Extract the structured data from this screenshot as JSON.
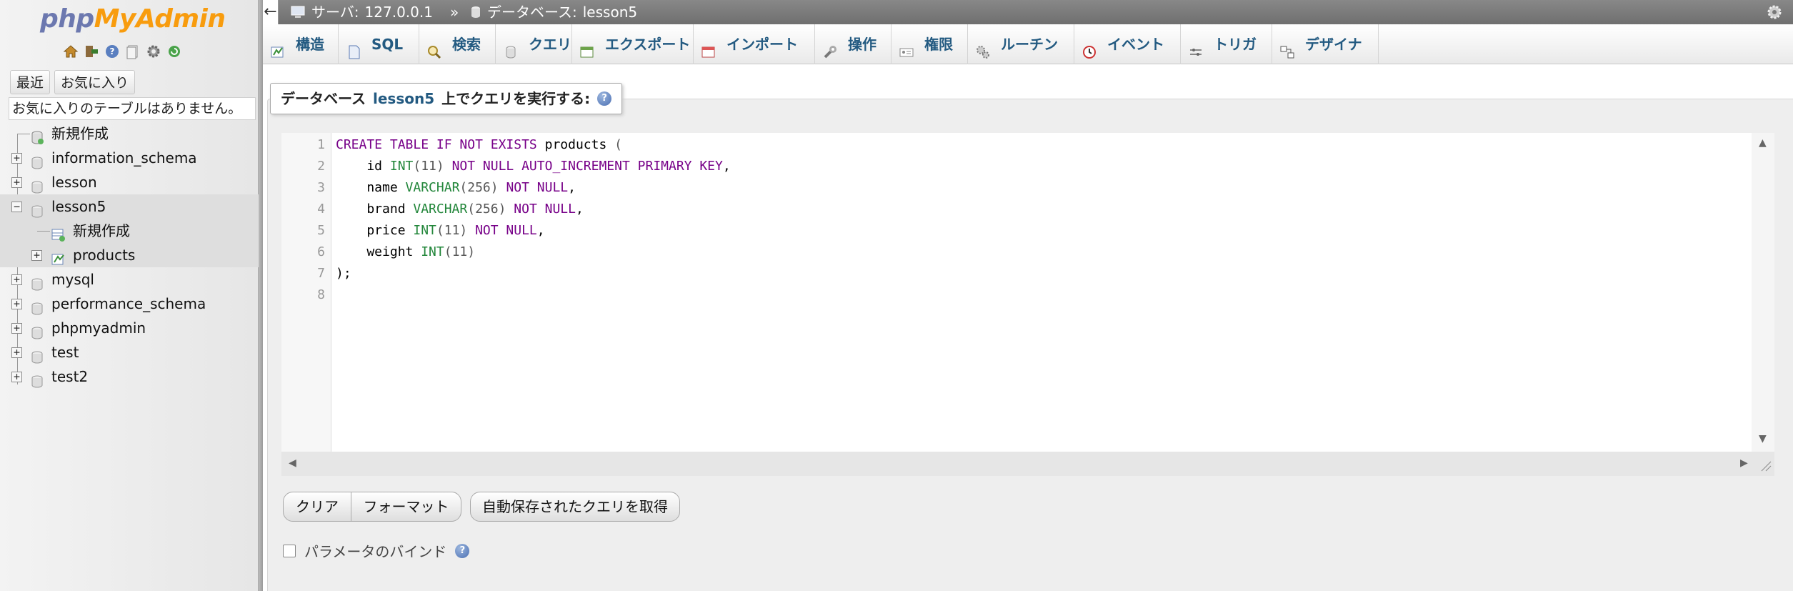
{
  "app": {
    "logo_php": "php",
    "logo_myadmin": "MyAdmin"
  },
  "colors": {
    "link_blue": "#235a81",
    "logo_blue": "#6c78af",
    "logo_orange": "#f89c0e",
    "keyword_purple": "#770088",
    "type_green": "#22863a"
  },
  "sidebar": {
    "nav_icons": [
      "home-icon",
      "logout-icon",
      "help-icon",
      "docs-icon",
      "settings-icon",
      "reload-icon"
    ],
    "tabs": [
      "最近",
      "お気に入り"
    ],
    "favorites_message": "お気に入りのテーブルはありません。",
    "tree": {
      "new_item": "新規作成",
      "databases": [
        {
          "name": "information_schema",
          "expander": "+"
        },
        {
          "name": "lesson",
          "expander": "+"
        },
        {
          "name": "lesson5",
          "expander": "−",
          "children": {
            "new_item": "新規作成",
            "table": "products"
          }
        },
        {
          "name": "mysql",
          "expander": "+"
        },
        {
          "name": "performance_schema",
          "expander": "+"
        },
        {
          "name": "phpmyadmin",
          "expander": "+"
        },
        {
          "name": "test",
          "expander": "+"
        },
        {
          "name": "test2",
          "expander": "+"
        }
      ]
    }
  },
  "breadcrumb": {
    "back": "←",
    "server_label": "サーバ:",
    "server_value": "127.0.0.1",
    "separator": "»",
    "database_label": "データベース:",
    "database_value": "lesson5"
  },
  "tabs": [
    {
      "label": "構造",
      "icon": "structure-icon"
    },
    {
      "label": "SQL",
      "icon": "sql-icon"
    },
    {
      "label": "検索",
      "icon": "search-icon"
    },
    {
      "label": "クエリ",
      "icon": "query-icon"
    },
    {
      "label": "エクスポート",
      "icon": "export-icon"
    },
    {
      "label": "インポート",
      "icon": "import-icon"
    },
    {
      "label": "操作",
      "icon": "wrench-icon"
    },
    {
      "label": "権限",
      "icon": "privileges-icon"
    },
    {
      "label": "ルーチン",
      "icon": "routines-icon"
    },
    {
      "label": "イベント",
      "icon": "events-icon"
    },
    {
      "label": "トリガ",
      "icon": "triggers-icon"
    },
    {
      "label": "デザイナ",
      "icon": "designer-icon"
    }
  ],
  "query": {
    "legend_prefix": "データベース",
    "legend_db": "lesson5",
    "legend_suffix": "上でクエリを実行する:",
    "line_numbers": [
      "1",
      "2",
      "3",
      "4",
      "5",
      "6",
      "7",
      "8"
    ],
    "code": [
      [
        {
          "t": "CREATE TABLE IF NOT EXISTS",
          "c": "kw"
        },
        {
          "t": " products ",
          "c": ""
        },
        {
          "t": "(",
          "c": "op"
        }
      ],
      [
        {
          "t": "    id ",
          "c": ""
        },
        {
          "t": "INT",
          "c": "ty"
        },
        {
          "t": "(11) ",
          "c": "op"
        },
        {
          "t": "NOT NULL AUTO_INCREMENT PRIMARY KEY",
          "c": "kw"
        },
        {
          "t": ",",
          "c": ""
        }
      ],
      [
        {
          "t": "    name ",
          "c": ""
        },
        {
          "t": "VARCHAR",
          "c": "ty"
        },
        {
          "t": "(256) ",
          "c": "op"
        },
        {
          "t": "NOT NULL",
          "c": "kw"
        },
        {
          "t": ",",
          "c": ""
        }
      ],
      [
        {
          "t": "    brand ",
          "c": ""
        },
        {
          "t": "VARCHAR",
          "c": "ty"
        },
        {
          "t": "(256) ",
          "c": "op"
        },
        {
          "t": "NOT NULL",
          "c": "kw"
        },
        {
          "t": ",",
          "c": ""
        }
      ],
      [
        {
          "t": "    price ",
          "c": ""
        },
        {
          "t": "INT",
          "c": "ty"
        },
        {
          "t": "(11) ",
          "c": "op"
        },
        {
          "t": "NOT NULL",
          "c": "kw"
        },
        {
          "t": ",",
          "c": ""
        }
      ],
      [
        {
          "t": "    weight ",
          "c": ""
        },
        {
          "t": "INT",
          "c": "ty"
        },
        {
          "t": "(11)",
          "c": "op"
        }
      ],
      [
        {
          "t": ");",
          "c": ""
        }
      ],
      []
    ],
    "buttons": {
      "clear": "クリア",
      "format": "フォーマット",
      "get_autosaved": "自動保存されたクエリを取得"
    },
    "bind_params_label": "パラメータのバインド"
  }
}
